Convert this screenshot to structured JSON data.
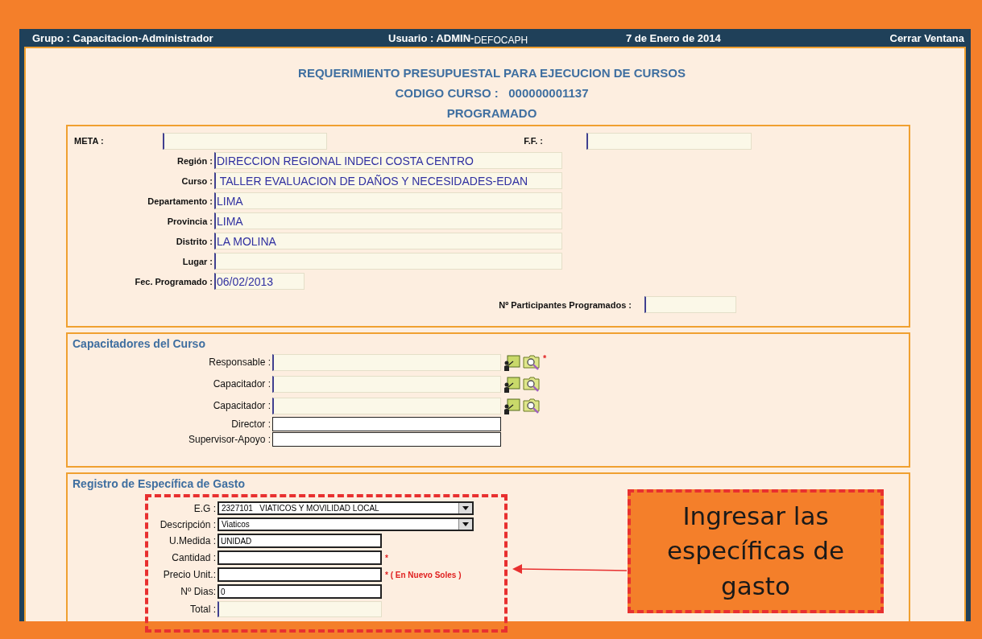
{
  "header": {
    "group": "Grupo : Capacitacion-Administrador",
    "user": "Usuario : ADMIN-",
    "user_suffix": "DEFOCAPH",
    "date": "7 de Enero de 2014",
    "close_link": "Cerrar Ventana"
  },
  "titles": [
    "REQUERIMIENTO PRESUPUESTAL PARA EJECUCION DE CURSOS",
    "CODIGO CURSO :   000000001137",
    "PROGRAMADO"
  ],
  "general": {
    "meta": {
      "label": "META :"
    },
    "ff": {
      "label": "F.F. :"
    },
    "fields": [
      {
        "label": "Región :",
        "value": "DIRECCION REGIONAL INDECI COSTA CENTRO",
        "kind": "text"
      },
      {
        "label": "Curso :",
        "value": " TALLER EVALUACION DE DAÑOS Y NECESIDADES-EDAN",
        "kind": "text"
      },
      {
        "label": "Departamento :",
        "value": "LIMA",
        "kind": "text"
      },
      {
        "label": "Provincia :",
        "value": "LIMA",
        "kind": "text"
      },
      {
        "label": "Distrito :",
        "value": "LA MOLINA",
        "kind": "text"
      },
      {
        "label": "Lugar :",
        "kind": "text"
      },
      {
        "label": "Fec. Programado :",
        "value": "06/02/2013",
        "kind": "date"
      }
    ],
    "participants": {
      "label": "Nº Participantes Programados :"
    }
  },
  "trainers": {
    "title": "Capacitadores del Curso",
    "rows": [
      {
        "label": "Responsable :",
        "kind": "lookup",
        "required": true
      },
      {
        "label": "Capacitador :",
        "kind": "lookup",
        "required": false
      },
      {
        "label": "Capacitador :",
        "kind": "lookup",
        "required": false
      },
      {
        "label": "Director :",
        "kind": "plain",
        "required": false
      },
      {
        "label": "Supervisor-Apoyo :",
        "kind": "plain",
        "required": false
      }
    ],
    "required_mark": "*"
  },
  "expense": {
    "title": "Registro de Específica de Gasto",
    "rows": [
      {
        "label": "E.G :",
        "kind": "select",
        "value": "2327101   VIATICOS Y MOVILIDAD LOCAL"
      },
      {
        "label": "Descripción :",
        "kind": "select",
        "value": "Viaticos"
      },
      {
        "label": "U.Medida :",
        "kind": "input",
        "value": "UNIDAD"
      },
      {
        "label": "Cantidad :",
        "kind": "input",
        "note": "*"
      },
      {
        "label": "Precio Unit.:",
        "kind": "input",
        "note": "* ( En Nuevo Soles )"
      },
      {
        "label": "Nº Dias:",
        "kind": "input",
        "value": "0"
      },
      {
        "label": "Total :",
        "kind": "readonly"
      }
    ]
  },
  "callout": {
    "text": "Ingresar las específicas de gasto"
  }
}
